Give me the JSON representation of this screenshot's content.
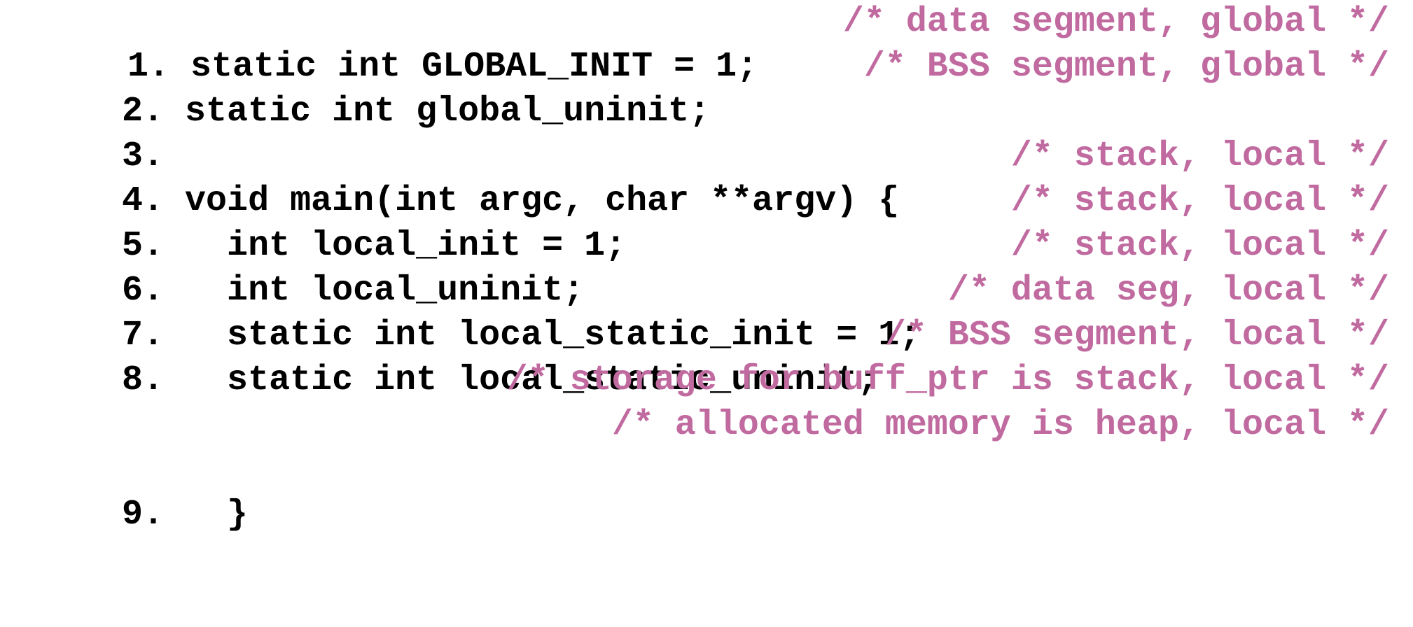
{
  "colors": {
    "code": "#000000",
    "comment": "#c06aa0"
  },
  "lines": [
    {
      "num": "1.",
      "code": " static int GLOBAL_INIT = 1;",
      "comment": "/* data segment, global */"
    },
    {
      "num": "2.",
      "code": " static int global_uninit;",
      "comment": "/* BSS segment, global */"
    },
    {
      "num": "3.",
      "code": "",
      "comment": ""
    },
    {
      "num": "4.",
      "code": " void main(int argc, char **argv) {",
      "comment": "/* stack, local */"
    },
    {
      "num": "5.",
      "code": "   int local_init = 1;",
      "comment": "/* stack, local */"
    },
    {
      "num": "6.",
      "code": "   int local_uninit;",
      "comment": "/* stack, local */"
    },
    {
      "num": "7.",
      "code": "   static int local_static_init = 1;",
      "comment": "/* data seg, local */"
    },
    {
      "num": "8.",
      "code": "   static int local_static_uninit;",
      "comment": "/* BSS segment, local */"
    },
    {
      "num": "",
      "code": "",
      "comment": "/* storage for buff_ptr is stack, local */"
    },
    {
      "num": "",
      "code": "",
      "comment": "/* allocated memory is heap, local */"
    },
    {
      "num": "9.",
      "code": "   }",
      "comment": ""
    }
  ]
}
